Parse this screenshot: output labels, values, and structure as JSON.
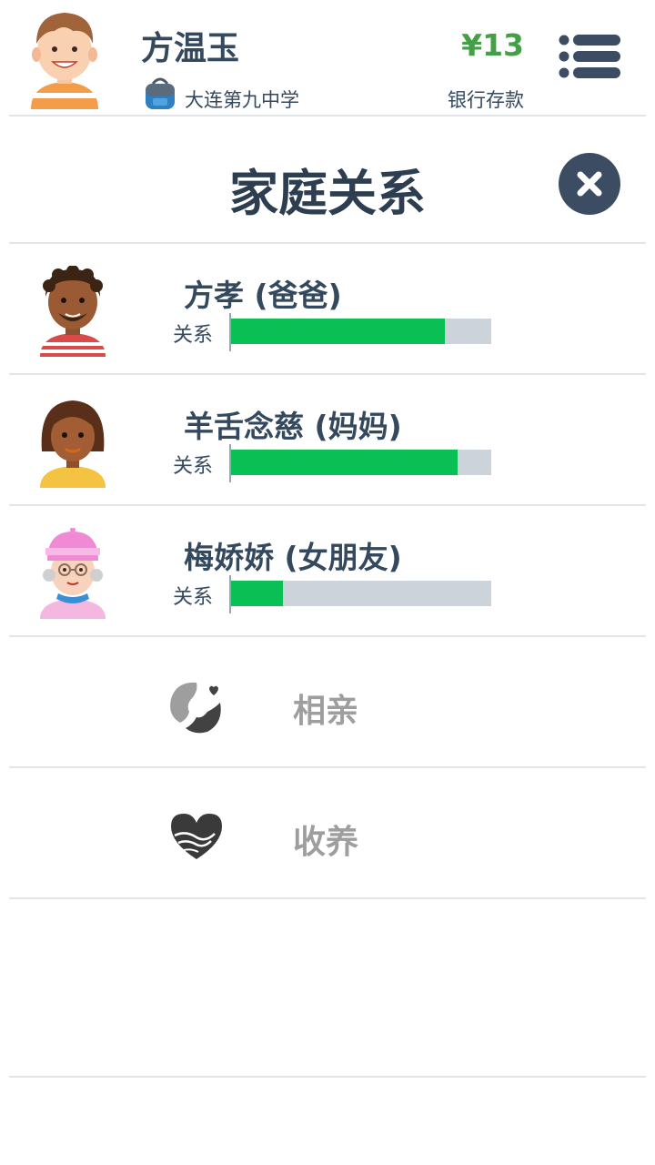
{
  "header": {
    "player_name": "方温玉",
    "school": "大连第九中学",
    "money": "¥13",
    "money_label": "银行存款"
  },
  "page": {
    "title": "家庭关系"
  },
  "relations": [
    {
      "name": "方孝 (爸爸)",
      "label": "关系",
      "level": 0.82
    },
    {
      "name": "羊舌念慈 (妈妈)",
      "label": "关系",
      "level": 0.87
    },
    {
      "name": "梅娇娇 (女朋友)",
      "label": "关系",
      "level": 0.2
    }
  ],
  "actions": [
    {
      "label": "相亲",
      "icon": "matchmaking-icon"
    },
    {
      "label": "收养",
      "icon": "adopt-heart-icon"
    }
  ],
  "colors": {
    "bar_fill": "#0abf53",
    "bar_track": "#ccd3da",
    "money": "#43a047",
    "title": "#2c3e50"
  }
}
